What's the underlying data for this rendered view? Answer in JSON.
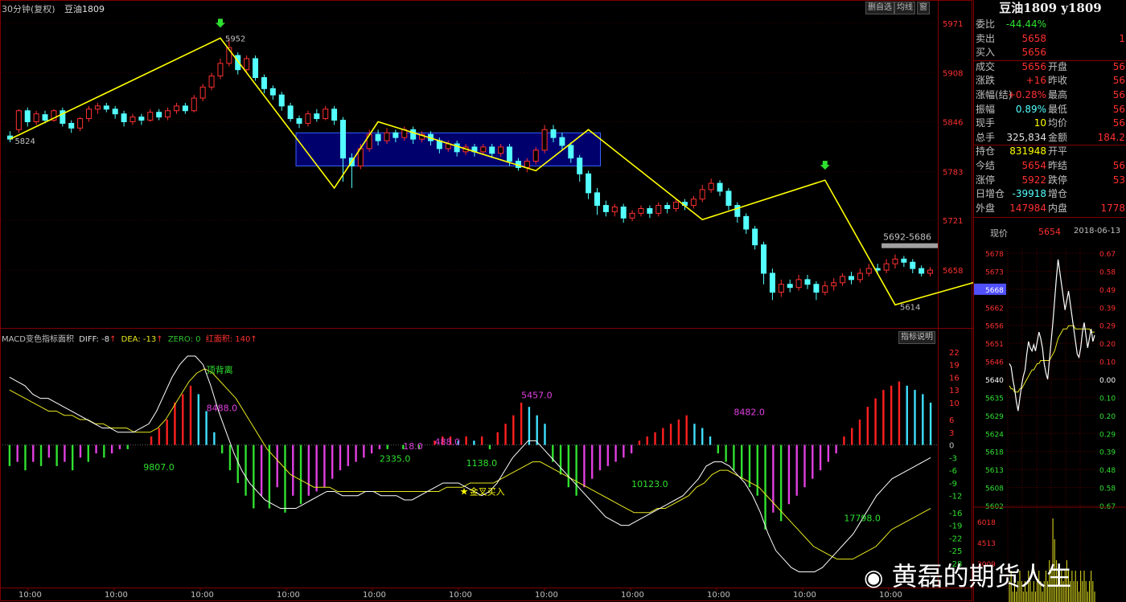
{
  "header": {
    "period": "30分钟(复权)",
    "symbol": "豆油1809",
    "btn_delete": "删自选",
    "btn_avg": "均线",
    "btn_window": "窗",
    "btn_indicator": "指标说明"
  },
  "macd_header": {
    "label": "MACD变色指标面积",
    "diff": "DIFF: -8",
    "dea": "DEA: -13",
    "zero": "ZERO: 0",
    "red_area": "红面积: 140"
  },
  "colors": {
    "up": "#ff3030",
    "down": "#54ffff",
    "zigzag": "#ffff00",
    "box_fill": "#000080",
    "box_stroke": "#3a62ff",
    "macd_red": "#ff2020",
    "macd_cyan": "#40e0ff",
    "macd_green": "#30e030",
    "macd_magenta": "#e040e0",
    "diff_line": "#ffffff",
    "dea_line": "#e8e820"
  },
  "chart_data": {
    "type": "candlestick",
    "y_ticks": [
      5971,
      5908,
      5846,
      5783,
      5721,
      5658
    ],
    "ylim": [
      5599,
      5983
    ],
    "x_ticks": [
      "10:00",
      "10:00",
      "10:00",
      "10:00",
      "10:00",
      "10:00",
      "10:00",
      "10:00",
      "10:00",
      "10:00",
      "10:00"
    ],
    "candles": [
      [
        5828,
        5824,
        5834,
        5820
      ],
      [
        5836,
        5860,
        5862,
        5832
      ],
      [
        5860,
        5846,
        5864,
        5840
      ],
      [
        5846,
        5856,
        5860,
        5842
      ],
      [
        5855,
        5848,
        5860,
        5844
      ],
      [
        5848,
        5860,
        5862,
        5846
      ],
      [
        5860,
        5844,
        5864,
        5840
      ],
      [
        5844,
        5838,
        5848,
        5832
      ],
      [
        5838,
        5850,
        5852,
        5834
      ],
      [
        5850,
        5862,
        5866,
        5846
      ],
      [
        5862,
        5866,
        5870,
        5856
      ],
      [
        5866,
        5862,
        5870,
        5858
      ],
      [
        5862,
        5856,
        5866,
        5850
      ],
      [
        5856,
        5846,
        5860,
        5840
      ],
      [
        5846,
        5852,
        5856,
        5842
      ],
      [
        5852,
        5848,
        5856,
        5842
      ],
      [
        5848,
        5858,
        5862,
        5846
      ],
      [
        5858,
        5852,
        5862,
        5848
      ],
      [
        5852,
        5860,
        5864,
        5848
      ],
      [
        5860,
        5866,
        5870,
        5856
      ],
      [
        5866,
        5860,
        5870,
        5856
      ],
      [
        5860,
        5876,
        5880,
        5858
      ],
      [
        5876,
        5890,
        5894,
        5872
      ],
      [
        5890,
        5904,
        5908,
        5886
      ],
      [
        5904,
        5920,
        5926,
        5900
      ],
      [
        5920,
        5940,
        5952,
        5916
      ],
      [
        5930,
        5912,
        5934,
        5906
      ],
      [
        5912,
        5926,
        5930,
        5908
      ],
      [
        5926,
        5902,
        5930,
        5898
      ],
      [
        5902,
        5888,
        5906,
        5882
      ],
      [
        5888,
        5880,
        5892,
        5874
      ],
      [
        5880,
        5866,
        5884,
        5860
      ],
      [
        5866,
        5850,
        5870,
        5846
      ],
      [
        5850,
        5844,
        5854,
        5838
      ],
      [
        5844,
        5856,
        5860,
        5840
      ],
      [
        5856,
        5850,
        5862,
        5846
      ],
      [
        5850,
        5862,
        5866,
        5848
      ],
      [
        5862,
        5848,
        5866,
        5842
      ],
      [
        5848,
        5800,
        5852,
        5770
      ],
      [
        5800,
        5790,
        5806,
        5762
      ],
      [
        5790,
        5812,
        5818,
        5786
      ],
      [
        5812,
        5830,
        5836,
        5808
      ],
      [
        5830,
        5822,
        5836,
        5816
      ],
      [
        5822,
        5832,
        5838,
        5818
      ],
      [
        5832,
        5826,
        5836,
        5820
      ],
      [
        5826,
        5836,
        5840,
        5822
      ],
      [
        5836,
        5824,
        5840,
        5818
      ],
      [
        5824,
        5830,
        5834,
        5820
      ],
      [
        5830,
        5822,
        5834,
        5816
      ],
      [
        5822,
        5812,
        5826,
        5806
      ],
      [
        5812,
        5818,
        5822,
        5808
      ],
      [
        5818,
        5808,
        5822,
        5802
      ],
      [
        5808,
        5814,
        5818,
        5804
      ],
      [
        5814,
        5808,
        5818,
        5802
      ],
      [
        5808,
        5814,
        5818,
        5804
      ],
      [
        5814,
        5806,
        5818,
        5800
      ],
      [
        5806,
        5814,
        5818,
        5802
      ],
      [
        5814,
        5796,
        5818,
        5790
      ],
      [
        5796,
        5788,
        5800,
        5784
      ],
      [
        5788,
        5796,
        5800,
        5782
      ],
      [
        5796,
        5810,
        5814,
        5792
      ],
      [
        5810,
        5836,
        5842,
        5806
      ],
      [
        5836,
        5826,
        5842,
        5820
      ],
      [
        5826,
        5816,
        5832,
        5810
      ],
      [
        5816,
        5800,
        5820,
        5794
      ],
      [
        5800,
        5780,
        5804,
        5770
      ],
      [
        5780,
        5756,
        5784,
        5748
      ],
      [
        5756,
        5740,
        5762,
        5728
      ],
      [
        5740,
        5732,
        5746,
        5726
      ],
      [
        5732,
        5738,
        5742,
        5726
      ],
      [
        5738,
        5724,
        5742,
        5718
      ],
      [
        5724,
        5730,
        5734,
        5720
      ],
      [
        5730,
        5736,
        5740,
        5726
      ],
      [
        5736,
        5730,
        5740,
        5724
      ],
      [
        5730,
        5740,
        5744,
        5726
      ],
      [
        5740,
        5736,
        5744,
        5730
      ],
      [
        5736,
        5744,
        5748,
        5732
      ],
      [
        5744,
        5740,
        5748,
        5734
      ],
      [
        5740,
        5748,
        5752,
        5736
      ],
      [
        5748,
        5760,
        5766,
        5744
      ],
      [
        5760,
        5768,
        5774,
        5756
      ],
      [
        5768,
        5758,
        5772,
        5752
      ],
      [
        5758,
        5740,
        5762,
        5734
      ],
      [
        5740,
        5726,
        5744,
        5718
      ],
      [
        5726,
        5710,
        5730,
        5704
      ],
      [
        5710,
        5690,
        5714,
        5684
      ],
      [
        5690,
        5654,
        5694,
        5640
      ],
      [
        5654,
        5630,
        5660,
        5620
      ],
      [
        5630,
        5640,
        5646,
        5624
      ],
      [
        5640,
        5636,
        5646,
        5630
      ],
      [
        5636,
        5646,
        5652,
        5632
      ],
      [
        5646,
        5640,
        5652,
        5634
      ],
      [
        5640,
        5630,
        5644,
        5620
      ],
      [
        5630,
        5638,
        5644,
        5626
      ],
      [
        5638,
        5642,
        5648,
        5632
      ],
      [
        5642,
        5650,
        5654,
        5638
      ],
      [
        5650,
        5646,
        5656,
        5640
      ],
      [
        5646,
        5654,
        5660,
        5642
      ],
      [
        5654,
        5660,
        5666,
        5650
      ],
      [
        5660,
        5658,
        5666,
        5652
      ],
      [
        5658,
        5666,
        5672,
        5654
      ],
      [
        5666,
        5672,
        5678,
        5660
      ],
      [
        5672,
        5668,
        5676,
        5662
      ],
      [
        5668,
        5660,
        5672,
        5654
      ],
      [
        5660,
        5654,
        5664,
        5650
      ],
      [
        5654,
        5658,
        5662,
        5650
      ]
    ],
    "zigzag": [
      [
        0,
        5824
      ],
      [
        24,
        5952
      ],
      [
        37,
        5762
      ],
      [
        42,
        5846
      ],
      [
        60,
        5784
      ],
      [
        66,
        5836
      ],
      [
        79,
        5722
      ],
      [
        93,
        5772
      ],
      [
        101,
        5614
      ],
      [
        120,
        5674
      ]
    ],
    "zigzag_labels": [
      {
        "idx": 24,
        "value": "5952"
      },
      {
        "idx": 0,
        "value": "5824"
      },
      {
        "idx": 101,
        "value": "5614"
      }
    ],
    "box": {
      "from": 33,
      "to": 67,
      "low": 5790,
      "high": 5832
    },
    "resistance": {
      "from": 100,
      "value": 5692,
      "label": "5692-5686"
    },
    "macd": {
      "ylim": [
        -32,
        25
      ],
      "y_ticks": [
        22,
        19,
        16,
        13,
        10,
        6,
        3,
        0,
        -3,
        -6,
        -9,
        -12,
        -16,
        -19,
        -22,
        -25,
        -28
      ],
      "hist": [
        -5,
        -4,
        -6,
        -4,
        -5,
        -3,
        -5,
        -4,
        -6,
        -3,
        -4,
        -2,
        -3,
        -2,
        -1,
        -1,
        0,
        0,
        2,
        4,
        6,
        10,
        12,
        14,
        12,
        8,
        3,
        -2,
        -6,
        -9,
        -12,
        -15,
        -12,
        -15,
        -10,
        -16,
        -12,
        -14,
        -12,
        -11,
        -10,
        -8,
        -6,
        -5,
        -4,
        -3,
        -2,
        -1,
        -1,
        0,
        -1,
        0,
        -1,
        0,
        1,
        2,
        2,
        1,
        2,
        1,
        2,
        -1,
        3,
        5,
        7,
        10,
        9,
        7,
        5,
        -4,
        -7,
        -10,
        -12,
        -10,
        -8,
        -6,
        -5,
        -4,
        -3,
        -2,
        1,
        2,
        3,
        4,
        5,
        6,
        7,
        5,
        4,
        2,
        -2,
        -4,
        -6,
        -8,
        -10,
        -12,
        -20,
        -16,
        -18,
        -14,
        -12,
        -10,
        -8,
        -6,
        -4,
        -2,
        2,
        4,
        6,
        9,
        11,
        13,
        14,
        15,
        14,
        13,
        12,
        10
      ],
      "diff": [
        16,
        15,
        14,
        12,
        11,
        11,
        10,
        9,
        8,
        7,
        6,
        5,
        4,
        4,
        3,
        3,
        3,
        4,
        5,
        8,
        12,
        16,
        19,
        21,
        21,
        19,
        14,
        8,
        3,
        -2,
        -6,
        -9,
        -11,
        -13,
        -14,
        -15,
        -15,
        -15,
        -14,
        -13,
        -12,
        -11,
        -11,
        -12,
        -12,
        -12,
        -11,
        -11,
        -12,
        -12,
        -12,
        -13,
        -13,
        -12,
        -11,
        -10,
        -9,
        -9,
        -9,
        -10,
        -11,
        -12,
        -11,
        -9,
        -6,
        -3,
        -1,
        1,
        1,
        -1,
        -3,
        -5,
        -7,
        -9,
        -11,
        -13,
        -15,
        -17,
        -18,
        -19,
        -19,
        -18,
        -17,
        -16,
        -15,
        -14,
        -13,
        -12,
        -10,
        -8,
        -5,
        -4,
        -4,
        -5,
        -7,
        -9,
        -12,
        -16,
        -21,
        -25,
        -27,
        -29,
        -30,
        -30,
        -30,
        -29,
        -27,
        -25,
        -23,
        -21,
        -18,
        -15,
        -12,
        -10,
        -8,
        -7,
        -6,
        -5,
        -4,
        -3
      ],
      "dea": [
        13,
        12,
        11,
        10,
        9,
        8,
        8,
        7,
        7,
        6,
        6,
        5,
        5,
        4,
        4,
        4,
        3,
        3,
        3,
        4,
        6,
        9,
        12,
        15,
        17,
        18,
        17,
        15,
        13,
        11,
        8,
        5,
        2,
        -1,
        -3,
        -5,
        -7,
        -8,
        -9,
        -10,
        -10,
        -10,
        -11,
        -11,
        -11,
        -11,
        -11,
        -11,
        -11,
        -11,
        -11,
        -11,
        -11,
        -11,
        -11,
        -11,
        -10,
        -10,
        -10,
        -9,
        -9,
        -9,
        -9,
        -8,
        -7,
        -6,
        -5,
        -4,
        -4,
        -5,
        -6,
        -7,
        -8,
        -9,
        -10,
        -11,
        -12,
        -13,
        -14,
        -15,
        -16,
        -16,
        -16,
        -15,
        -15,
        -14,
        -13,
        -12,
        -10,
        -9,
        -7,
        -6,
        -6,
        -7,
        -8,
        -9,
        -10,
        -12,
        -14,
        -16,
        -18,
        -20,
        -22,
        -24,
        -25,
        -26,
        -27,
        -27,
        -27,
        -26,
        -25,
        -24,
        -22,
        -20,
        -19,
        -18,
        -17,
        -16,
        -15
      ],
      "labels": [
        {
          "text": "顶背离",
          "idx": 25,
          "value": 17,
          "color": "#30e030"
        },
        {
          "text": "8488.0",
          "idx": 25,
          "value": 8,
          "color": "#e040e0"
        },
        {
          "text": "9807.0",
          "idx": 17,
          "value": -6,
          "color": "#30e030"
        },
        {
          "text": "2335.0",
          "idx": 47,
          "value": -4,
          "color": "#30e030"
        },
        {
          "text": "18.0",
          "idx": 50,
          "value": -1,
          "color": "#e040e0"
        },
        {
          "text": "488.0",
          "idx": 54,
          "value": 0,
          "color": "#e040e0"
        },
        {
          "text": "1138.0",
          "idx": 58,
          "value": -5,
          "color": "#30e030"
        },
        {
          "text": "5457.0",
          "idx": 65,
          "value": 11,
          "color": "#e040e0"
        },
        {
          "text": "10123.0",
          "idx": 79,
          "value": -10,
          "color": "#30e030"
        },
        {
          "text": "8482.0",
          "idx": 92,
          "value": 7,
          "color": "#e040e0"
        },
        {
          "text": "17798.0",
          "idx": 106,
          "value": -18,
          "color": "#30e030"
        }
      ],
      "golden_cross": {
        "text": "金叉买入",
        "idx": 58,
        "value": -11
      }
    }
  },
  "quote": {
    "title": "豆油1809 y1809",
    "rows": [
      {
        "l": "委比",
        "v": "-44.44%",
        "vc": "#30e030",
        "l2": "",
        "v2": ""
      },
      {
        "l": "卖出",
        "v": "5658",
        "vc": "#ff3030",
        "l2": "",
        "v2": "1"
      },
      {
        "l": "买入",
        "v": "5656",
        "vc": "#ff3030",
        "l2": "",
        "v2": ""
      },
      {
        "l": "成交",
        "v": "5656",
        "vc": "#ff3030",
        "l2": "开盘",
        "v2": "56"
      },
      {
        "l": "涨跌",
        "v": "+16",
        "vc": "#ff3030",
        "l2": "昨收",
        "v2": "56"
      },
      {
        "l": "涨幅(结)",
        "v": "+0.28%",
        "vc": "#ff3030",
        "l2": "最高",
        "v2": "56"
      },
      {
        "l": "振幅",
        "v": "0.89%",
        "vc": "#54ffff",
        "l2": "最低",
        "v2": "56"
      },
      {
        "l": "现手",
        "v": "10",
        "vc": "#ffff00",
        "l2": "均价",
        "v2": "56"
      },
      {
        "l": "总手",
        "v": "325,834",
        "vc": "#e0e0e0",
        "l2": "金额",
        "v2": "184.2"
      },
      {
        "l": "持仓",
        "v": "831948",
        "vc": "#ffff00",
        "l2": "开平",
        "v2": ""
      },
      {
        "l": "今结",
        "v": "5654",
        "vc": "#ff3030",
        "l2": "昨结",
        "v2": "56"
      },
      {
        "l": "涨停",
        "v": "5922",
        "vc": "#ff3030",
        "l2": "跌停",
        "v2": "53"
      },
      {
        "l": "日增仓",
        "v": "-39918",
        "vc": "#54ffff",
        "l2": "增仓",
        "v2": ""
      },
      {
        "l": "外盘",
        "v": "147984",
        "vc": "#ff3030",
        "l2": "内盘",
        "v2": "1778"
      }
    ],
    "price_label": "现价",
    "price_value": "5654",
    "date": "2018-06-13"
  },
  "mini_chart": {
    "left_ticks": [
      "5678",
      "5673",
      "5668",
      "5662",
      "5656",
      "5651",
      "5646",
      "5640",
      "5635",
      "5629",
      "5624",
      "5618",
      "5613",
      "5608",
      "5602"
    ],
    "right_ticks": [
      "0.67",
      "0.58",
      "0.49",
      "0.39",
      "0.29",
      "0.20",
      "0.10",
      "0.00",
      "0.10",
      "0.20",
      "0.29",
      "0.39",
      "0.48",
      "0.58",
      "0.67"
    ],
    "vol_ticks": [
      "6018",
      "4513",
      "3009"
    ],
    "highlight": "5668",
    "price": [
      5645,
      5644,
      5640,
      5637,
      5633,
      5630,
      5634,
      5638,
      5641,
      5643,
      5648,
      5652,
      5650,
      5649,
      5651,
      5649,
      5652,
      5655,
      5653,
      5650,
      5645,
      5642,
      5640,
      5646,
      5652,
      5658,
      5665,
      5672,
      5678,
      5674,
      5670,
      5666,
      5662,
      5665,
      5668,
      5664,
      5660,
      5656,
      5652,
      5648,
      5647,
      5650,
      5655,
      5658,
      5654,
      5650,
      5653,
      5656,
      5652,
      5654
    ],
    "avg": [
      5638,
      5637,
      5637,
      5636,
      5636,
      5636,
      5637,
      5637,
      5638,
      5639,
      5640,
      5641,
      5642,
      5643,
      5643,
      5644,
      5645,
      5645,
      5646,
      5646,
      5646,
      5646,
      5646,
      5646,
      5647,
      5648,
      5649,
      5651,
      5653,
      5654,
      5655,
      5656,
      5656,
      5656,
      5657,
      5657,
      5657,
      5657,
      5656,
      5656,
      5656,
      5656,
      5656,
      5656,
      5656,
      5656,
      5656,
      5655,
      5655,
      5655
    ],
    "volume": [
      2,
      3,
      1,
      2,
      1,
      2,
      3,
      2,
      1,
      2,
      1,
      3,
      2,
      1,
      2,
      1,
      2,
      3,
      2,
      1,
      2,
      3,
      2,
      4,
      3,
      8,
      6,
      4,
      3,
      2,
      3,
      2,
      3,
      4,
      3,
      2,
      3,
      2,
      3,
      2,
      1,
      3,
      2,
      3,
      2,
      1,
      2,
      3,
      2,
      1
    ]
  },
  "watermark": "黄磊的期货人生"
}
